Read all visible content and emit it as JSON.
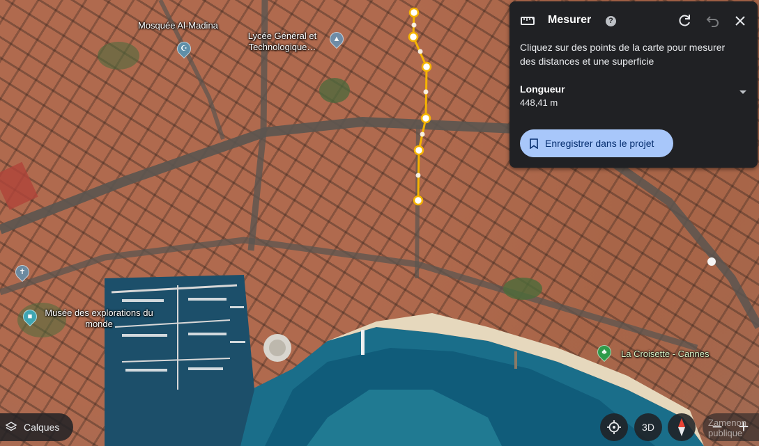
{
  "map": {
    "places": [
      {
        "name": "Mosquée Al-Madina",
        "icon": "mosque-icon"
      },
      {
        "name": "Lycée Général et Technologique…",
        "icon": "school-icon"
      },
      {
        "name": "Musée des explorations du monde",
        "icon": "museum-icon"
      },
      {
        "name": "La Croisette - Cannes",
        "icon": "tree-icon"
      }
    ],
    "route_color": "#f5b400"
  },
  "measure_panel": {
    "title": "Mesurer",
    "help_icon": "?",
    "description": "Cliquez sur des points de la carte pour mesurer des distances et une superficie",
    "metric_label": "Longueur",
    "metric_value": "448,41 m",
    "save_label": "Enregistrer dans le projet",
    "icons": [
      "ruler-icon",
      "help-icon",
      "redo-icon",
      "undo-icon",
      "close-icon",
      "bookmark-icon",
      "caret-down-icon"
    ]
  },
  "controls": {
    "layers_label": "Calques",
    "view_3d_label": "3D",
    "zoom_in": "+",
    "zoom_out": "−",
    "public_label": "Zamenon publique"
  },
  "colors": {
    "panel_bg": "#202124",
    "primary_button": "#a8c7fa",
    "primary_button_text": "#062e6f"
  }
}
